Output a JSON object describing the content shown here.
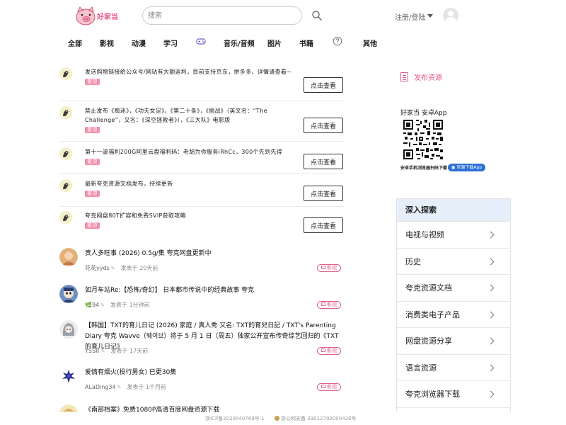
{
  "header": {
    "logo_text": "好家当",
    "search_placeholder": "搜索",
    "login_label": "注册/登陆"
  },
  "nav": [
    "全部",
    "影视",
    "动漫",
    "学习",
    "音乐/音频",
    "图片",
    "书籍",
    "其他"
  ],
  "announcements": [
    {
      "text": "发送购物链接给公众号/网站有大额返利，目前支持京东，拼多多，详情请查看~",
      "tag": "置顶",
      "button": "点击查看"
    },
    {
      "text": "禁止发布《痴迷》，《功夫女足》，《第二十条》，《挑战》（英文名：“The Challenge”，又名：《深空拯救者》），《三大队》电影版",
      "tag": "置顶",
      "button": "点击查看"
    },
    {
      "text": "第十一波福利200G阿里云盘福利码：老胡为你服务iRhCc，300个先到先得",
      "tag": "置顶",
      "button": "点击查看"
    },
    {
      "text": "最新夸克资源文档发布，持续更新",
      "tag": "置顶",
      "button": "点击查看"
    },
    {
      "text": "夸克网盘80T扩容和免费SVIP获取攻略",
      "tag": "置顶",
      "button": "点击查看"
    }
  ],
  "posts": [
    {
      "title": "贵人多旺事 (2026) 0.5g/集 夸克网盘更新中",
      "author": "花花yyds",
      "time": "发表于 20天前",
      "tag": "影视"
    },
    {
      "title": "如月车站Re:【恐怖/奇幻】 日本都市传说中的经典故事 夸克",
      "author": "94",
      "time": "发表于 1分钟前",
      "tag": "影视"
    },
    {
      "title": "【韩国】TXT的育儿日记 (2026) 家庭 / 真人秀 又名: TXT的育兒日記 / TXT's Parenting Diary 夸克 Wavve（웨이브）将于 5 月 1 日（周五）独家公开宣布传奇综艺回归的《TXT的育儿日记》",
      "author": "YSSR",
      "time": "发表于 17天前",
      "tag": "影视"
    },
    {
      "title": "爱情有烟火(投行男女) 已更30集",
      "author": "ALaDing34",
      "time": "发表于 1个月前",
      "tag": "影视"
    },
    {
      "title": "《南部档案》免费1080P高清百度网盘资源下载",
      "author": "",
      "time": "",
      "tag": ""
    }
  ],
  "sidebar": {
    "publish_label": "发布资源",
    "app_title": "好家当 安卓App",
    "qr_caption": "安卓手机浏览器扫码下载",
    "app_button": "官源下载App",
    "explore_title": "深入探索",
    "explore_items": [
      "电视与视频",
      "历史",
      "夸克资源文档",
      "消费类电子产品",
      "网盘资源分享",
      "语言资源",
      "夸克浏览器下载"
    ]
  },
  "footer": {
    "icp": "浙ICP备2020040769号-1",
    "beian": "浙公网安备 33012702000426号"
  }
}
